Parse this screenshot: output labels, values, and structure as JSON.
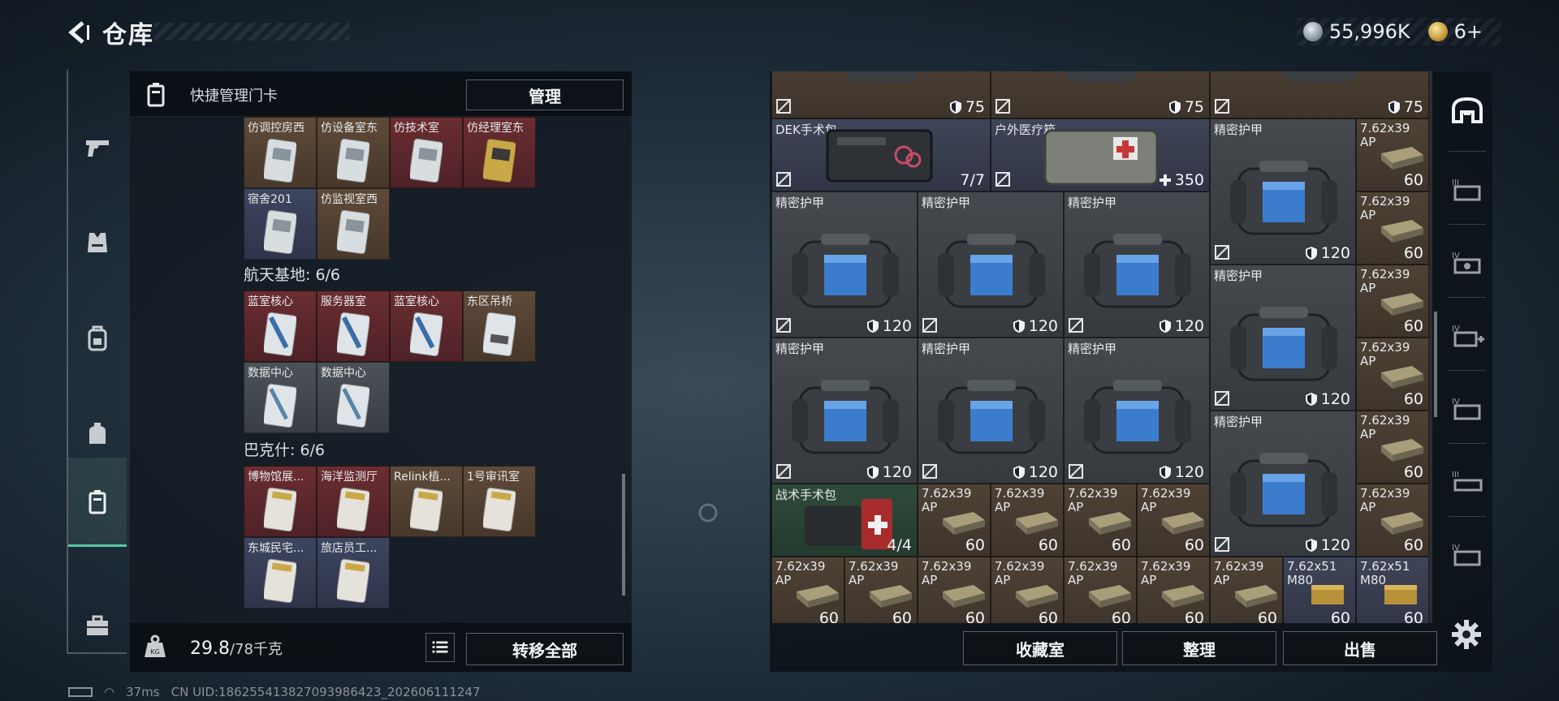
{
  "header": {
    "title": "仓库"
  },
  "currency": {
    "silver": "55,996K",
    "gold": "6+"
  },
  "left_panel": {
    "header_label": "快捷管理门卡",
    "manage_label": "管理",
    "sections": [
      {
        "title": "",
        "cards": [
          {
            "label": "仿调控房西",
            "color": "brown"
          },
          {
            "label": "仿设备室东",
            "color": "brown"
          },
          {
            "label": "仿技术室",
            "color": "red"
          },
          {
            "label": "仿经理室东",
            "color": "red"
          },
          {
            "label": "宿舍201",
            "color": "blue"
          },
          {
            "label": "仿监视室西",
            "color": "brown"
          }
        ]
      },
      {
        "title": "航天基地: 6/6",
        "cards": [
          {
            "label": "蓝室核心",
            "color": "red"
          },
          {
            "label": "服务器室",
            "color": "red"
          },
          {
            "label": "蓝室核心",
            "color": "red"
          },
          {
            "label": "东区吊桥",
            "color": "brown"
          },
          {
            "label": "数据中心",
            "color": "gray"
          },
          {
            "label": "数据中心",
            "color": "gray"
          }
        ]
      },
      {
        "title": "巴克什: 6/6",
        "cards": [
          {
            "label": "博物馆展...",
            "color": "red"
          },
          {
            "label": "海洋监测厅",
            "color": "red"
          },
          {
            "label": "Relink植...",
            "color": "brown"
          },
          {
            "label": "1号审讯室",
            "color": "brown"
          },
          {
            "label": "东城民宅...",
            "color": "blue"
          },
          {
            "label": "旅店员工...",
            "color": "blue"
          }
        ]
      }
    ],
    "weight": "29.8",
    "weight_max": "/78千克",
    "transfer_label": "转移全部"
  },
  "right_panel": {
    "top_row": [
      {
        "value": "75"
      },
      {
        "value": "75"
      },
      {
        "value": "75"
      }
    ],
    "surgery_kit": {
      "name": "DEK手术包",
      "value": "7/7"
    },
    "medical_box": {
      "name": "户外医疗箱",
      "value": "350"
    },
    "armor_name": "精密护甲",
    "armor_value": "120",
    "tactical_kit": {
      "name": "战术手术包",
      "value": "4/4"
    },
    "ammo_name_a": "7.62x39",
    "ammo_name_b": "AP",
    "ammo_value": "60",
    "ammo51_a": "7.62x51",
    "ammo51_b": "M80",
    "buttons": {
      "collection": "收藏室",
      "organize": "整理",
      "sell": "出售"
    }
  },
  "status": {
    "ping": "37ms",
    "uid": "CN UID:186255413827093986423_202606111247"
  }
}
